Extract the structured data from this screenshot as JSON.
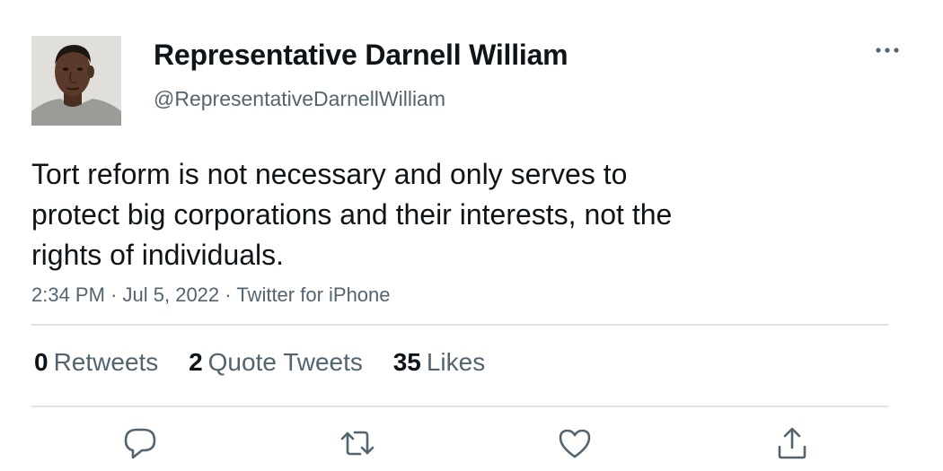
{
  "author": {
    "display_name": "Representative Darnell William",
    "handle": "@RepresentativeDarnellWilliam",
    "avatar_icon": "profile-photo"
  },
  "tweet": {
    "text_lines": [
      "Tort reform is not necessary and only serves to",
      "protect big corporations and their interests, not the",
      "rights of individuals."
    ],
    "time": "2:34 PM",
    "separator": "·",
    "date": "Jul 5, 2022",
    "source": "Twitter for iPhone"
  },
  "stats": {
    "retweets_count": "0",
    "retweets_label": "Retweets",
    "quotes_count": "2",
    "quotes_label": "Quote Tweets",
    "likes_count": "35",
    "likes_label": "Likes"
  },
  "actions": {
    "reply_icon": "reply-icon",
    "retweet_icon": "retweet-icon",
    "like_icon": "heart-icon",
    "share_icon": "share-icon",
    "more_icon": "more-icon"
  },
  "colors": {
    "text_primary": "#0f1419",
    "text_secondary": "#536471",
    "divider": "#dfe3e6",
    "icon": "#536471"
  }
}
